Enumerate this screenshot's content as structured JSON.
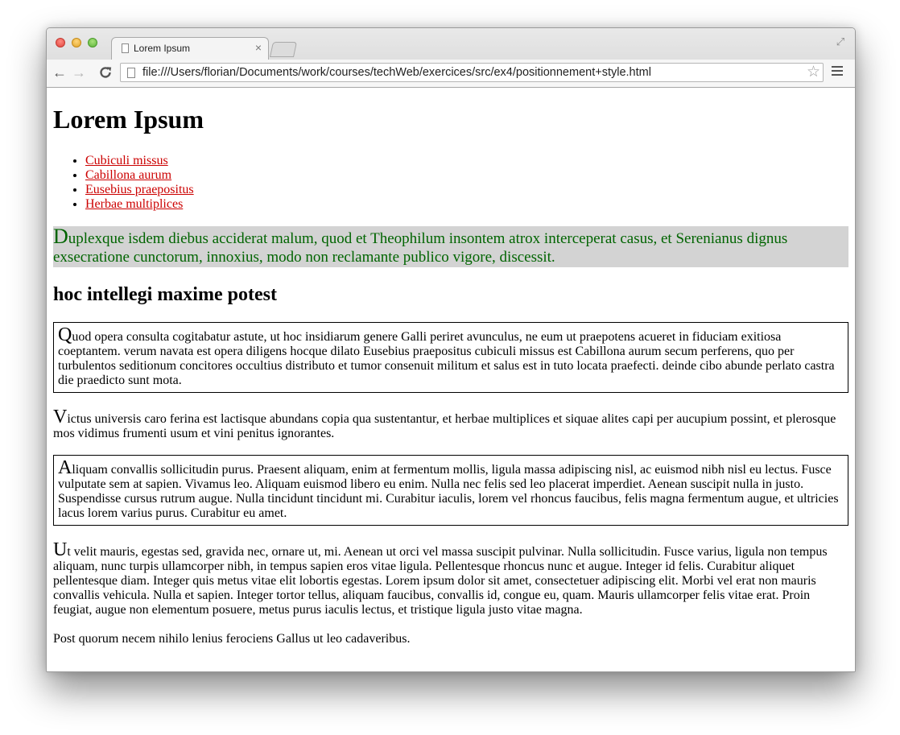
{
  "browser": {
    "tab_title": "Lorem Ipsum",
    "tab_close": "×",
    "url": "file:///Users/florian/Documents/work/courses/techWeb/exercices/src/ex4/positionnement+style.html",
    "back_icon": "←",
    "forward_icon": "→",
    "reload_icon": "C",
    "star_icon": "☆",
    "fullscreen_icon": "⤢"
  },
  "page": {
    "title": "Lorem Ipsum",
    "nav_links": [
      "Cubiculi missus",
      "Cabillona aurum",
      "Eusebius praepositus",
      "Herbae multiplices"
    ],
    "intro_initial": "D",
    "intro_rest": "uplexque isdem diebus acciderat malum, quod et Theophilum insontem atrox interceperat casus, et Serenianus dignus exsecratione cunctorum, innoxius, modo non reclamante publico vigore, discessit.",
    "subtitle": "hoc intellegi maxime potest",
    "p1_initial": "Q",
    "p1_rest": "uod opera consulta cogitabatur astute, ut hoc insidiarum genere Galli periret avunculus, ne eum ut praepotens acueret in fiduciam exitiosa coeptantem. verum navata est opera diligens hocque dilato Eusebius praepositus cubiculi missus est Cabillona aurum secum perferens, quo per turbulentos seditionum concitores occultius distributo et tumor consenuit militum et salus est in tuto locata praefecti. deinde cibo abunde perlato castra die praedicto sunt mota.",
    "p2_initial": "V",
    "p2_rest": "ictus universis caro ferina est lactisque abundans copia qua sustentantur, et herbae multiplices et siquae alites capi per aucupium possint, et plerosque mos vidimus frumenti usum et vini penitus ignorantes.",
    "p3_initial": "A",
    "p3_rest": "liquam convallis sollicitudin purus. Praesent aliquam, enim at fermentum mollis, ligula massa adipiscing nisl, ac euismod nibh nisl eu lectus. Fusce vulputate sem at sapien. Vivamus leo. Aliquam euismod libero eu enim. Nulla nec felis sed leo placerat imperdiet. Aenean suscipit nulla in justo. Suspendisse cursus rutrum augue. Nulla tincidunt tincidunt mi. Curabitur iaculis, lorem vel rhoncus faucibus, felis magna fermentum augue, et ultricies lacus lorem varius purus. Curabitur eu amet.",
    "p4_initial": "U",
    "p4_rest": "t velit mauris, egestas sed, gravida nec, ornare ut, mi. Aenean ut orci vel massa suscipit pulvinar. Nulla sollicitudin. Fusce varius, ligula non tempus aliquam, nunc turpis ullamcorper nibh, in tempus sapien eros vitae ligula. Pellentesque rhoncus nunc et augue. Integer id felis. Curabitur aliquet pellentesque diam. Integer quis metus vitae elit lobortis egestas. Lorem ipsum dolor sit amet, consectetuer adipiscing elit. Morbi vel erat non mauris convallis vehicula. Nulla et sapien. Integer tortor tellus, aliquam faucibus, convallis id, congue eu, quam. Mauris ullamcorper felis vitae erat. Proin feugiat, augue non elementum posuere, metus purus iaculis lectus, et tristique ligula justo vitae magna.",
    "p5": "Post quorum necem nihilo lenius ferociens Gallus ut leo cadaveribus."
  },
  "colors": {
    "link": "#cc0000",
    "intro_text": "#006400",
    "intro_bg": "#d3d3d3"
  }
}
